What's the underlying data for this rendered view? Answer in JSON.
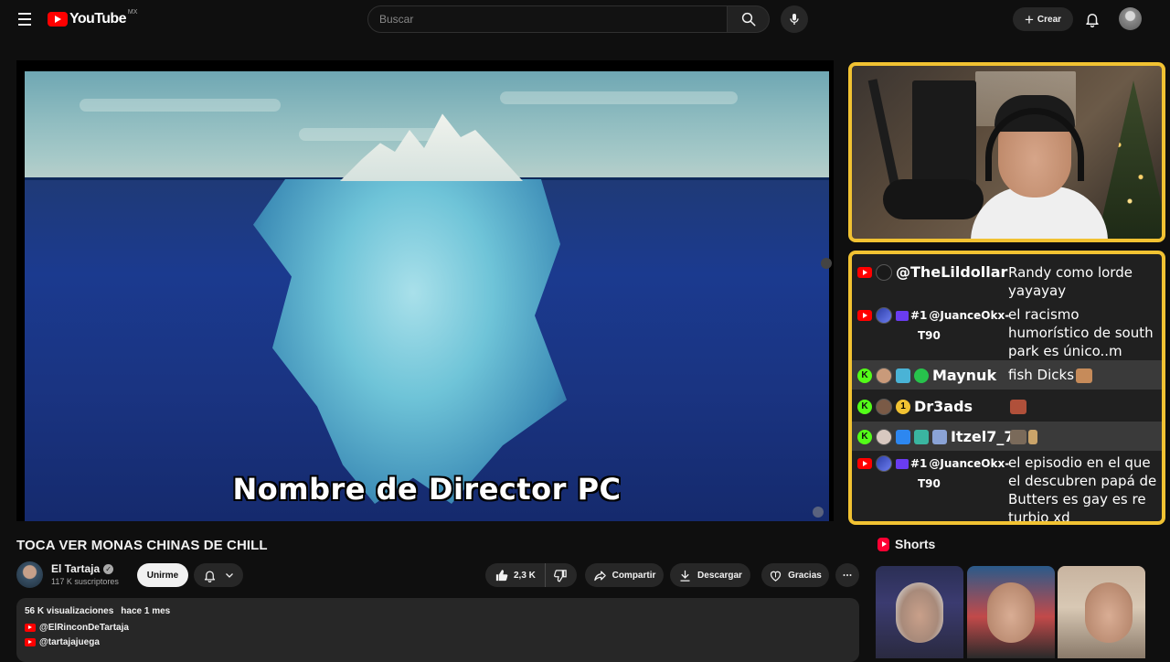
{
  "header": {
    "logo_text": "YouTube",
    "logo_region": "MX",
    "search_placeholder": "Buscar",
    "create_label": "Crear"
  },
  "video": {
    "subtitle": "Nombre de Director PC",
    "title": "TOCA VER MONAS CHINAS DE CHILL"
  },
  "chat": {
    "messages": [
      {
        "platform": "youtube",
        "user": "@TheLildollar",
        "user_line2": "",
        "text": "Randy como lorde yayayay"
      },
      {
        "platform": "youtube",
        "user": "@JuanceOkx-",
        "user_line2": "T90",
        "badge": "#1",
        "text": "el racismo humorístico de south park es único..m"
      },
      {
        "platform": "kick",
        "user": "Maynuk",
        "user_line2": "",
        "text": "fish Dicks"
      },
      {
        "platform": "kick",
        "user": "Dr3ads",
        "user_line2": "",
        "badge": "1",
        "text": ""
      },
      {
        "platform": "kick",
        "user": "Itzel7_7",
        "user_line2": "",
        "text": ""
      },
      {
        "platform": "youtube",
        "user": "@JuanceOkx-",
        "user_line2": "T90",
        "badge": "#1",
        "text": "el episodio en el que el descubren papá de Butters es gay es re turbio xd"
      }
    ]
  },
  "channel": {
    "name": "El Tartaja",
    "subscribers": "117 K suscriptores",
    "join_label": "Unirme"
  },
  "actions": {
    "likes": "2,3 K",
    "share_label": "Compartir",
    "download_label": "Descargar",
    "thanks_label": "Gracias"
  },
  "description": {
    "views": "56 K visualizaciones",
    "date": "hace 1 mes",
    "links": [
      "@ElRinconDeTartaja",
      "@tartajajuega"
    ]
  },
  "shorts": {
    "label": "Shorts"
  },
  "colors": {
    "background": "#0f0f0f",
    "overlay_border": "#f1c232",
    "youtube_red": "#ff0000",
    "kick_green": "#53fc18"
  }
}
